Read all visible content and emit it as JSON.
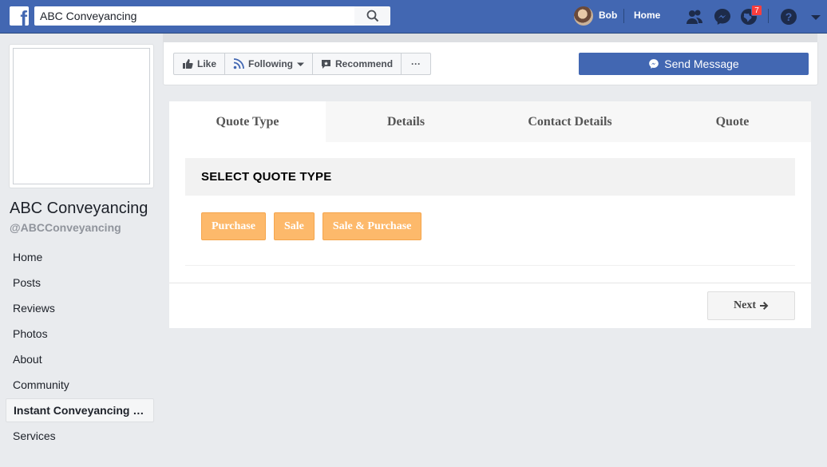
{
  "topbar": {
    "search_value": "ABC Conveyancing",
    "user_name": "Bob",
    "home_label": "Home",
    "notification_count": "7",
    "brand_color": "#4267b2"
  },
  "page": {
    "name": "ABC Conveyancing",
    "handle": "@ABCConveyancing"
  },
  "sidebar": {
    "items": [
      {
        "label": "Home"
      },
      {
        "label": "Posts"
      },
      {
        "label": "Reviews"
      },
      {
        "label": "Photos"
      },
      {
        "label": "About"
      },
      {
        "label": "Community"
      },
      {
        "label": "Instant Conveyancing Quote"
      },
      {
        "label": "Services"
      }
    ]
  },
  "actions": {
    "like_label": "Like",
    "following_label": "Following",
    "recommend_label": "Recommend",
    "more_label": "···",
    "send_message_label": "Send Message"
  },
  "quote": {
    "tabs": [
      {
        "label": "Quote Type"
      },
      {
        "label": "Details"
      },
      {
        "label": "Contact Details"
      },
      {
        "label": "Quote"
      }
    ],
    "section_title": "SELECT QUOTE TYPE",
    "options": [
      {
        "label": "Purchase"
      },
      {
        "label": "Sale"
      },
      {
        "label": "Sale & Purchase"
      }
    ],
    "next_label": "Next",
    "accent_color": "#fdb96b"
  }
}
